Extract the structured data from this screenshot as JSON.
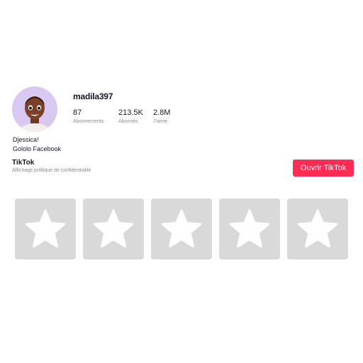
{
  "profile": {
    "username": "madila397",
    "stats": [
      {
        "value": "87",
        "label": "Abonnements"
      },
      {
        "value": "213.5K",
        "label": "Abonnés"
      },
      {
        "value": "2.8M",
        "label": "J'aime"
      }
    ],
    "bio_lines": [
      "Djessica!",
      "Gololo Facebook"
    ]
  },
  "footer": {
    "brand": "TikTok",
    "policy": "Affichage politique de confidentialité",
    "open_button": "Ouvrir TikTok"
  },
  "thumbnails": [
    {
      "icon": "star-icon"
    },
    {
      "icon": "star-icon"
    },
    {
      "icon": "star-icon"
    },
    {
      "icon": "star-icon"
    },
    {
      "icon": "star-icon"
    }
  ],
  "colors": {
    "accent": "#fe2c55",
    "placeholder": "#d9d9d9",
    "avatar_bg": "#d9c8f2"
  }
}
